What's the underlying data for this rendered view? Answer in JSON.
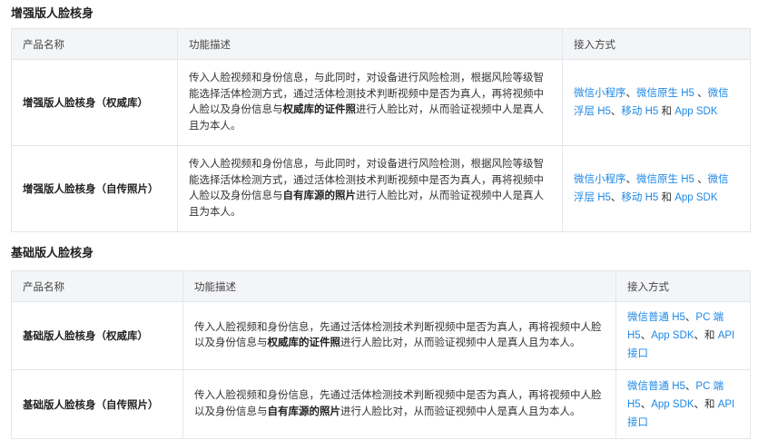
{
  "sections": [
    {
      "title": "增强版人脸核身",
      "headers": [
        "产品名称",
        "功能描述",
        "接入方式"
      ],
      "rows": [
        {
          "name": "增强版人脸核身（权威库）",
          "desc_before": "传入人脸视频和身份信息，与此同时，对设备进行风险检测，根据风险等级智能选择活体检测方式，通过活体检测技术判断视频中是否为真人，再将视频中人脸以及身份信息与",
          "desc_bold": "权威库的证件照",
          "desc_after": "进行人脸比对，从而验证视频中人是真人且为本人。",
          "access": [
            {
              "t": "微信小程序",
              "link": true
            },
            {
              "t": "、",
              "link": false
            },
            {
              "t": "微信原生 H5",
              "link": true
            },
            {
              "t": " 、",
              "link": false
            },
            {
              "t": "微信浮层 H5",
              "link": true
            },
            {
              "t": "、",
              "link": false
            },
            {
              "t": "移动 H5",
              "link": true
            },
            {
              "t": " 和 ",
              "link": false
            },
            {
              "t": "App SDK",
              "link": true
            }
          ]
        },
        {
          "name": "增强版人脸核身（自传照片）",
          "desc_before": "传入人脸视频和身份信息，与此同时，对设备进行风险检测，根据风险等级智能选择活体检测方式，通过活体检测技术判断视频中是否为真人，再将视频中人脸以及身份信息与",
          "desc_bold": "自有库源的照片",
          "desc_after": "进行人脸比对，从而验证视频中人是真人且为本人。",
          "access": [
            {
              "t": "微信小程序",
              "link": true
            },
            {
              "t": "、",
              "link": false
            },
            {
              "t": "微信原生 H5",
              "link": true
            },
            {
              "t": " 、",
              "link": false
            },
            {
              "t": "微信浮层 H5",
              "link": true
            },
            {
              "t": "、",
              "link": false
            },
            {
              "t": "移动 H5",
              "link": true
            },
            {
              "t": " 和 ",
              "link": false
            },
            {
              "t": "App SDK",
              "link": true
            }
          ]
        }
      ]
    },
    {
      "title": "基础版人脸核身",
      "headers": [
        "产品名称",
        "功能描述",
        "接入方式"
      ],
      "rows": [
        {
          "name": "基础版人脸核身（权威库）",
          "desc_before": "传入人脸视频和身份信息，先通过活体检测技术判断视频中是否为真人，再将视频中人脸以及身份信息与",
          "desc_bold": "权威库的证件照",
          "desc_after": "进行人脸比对，从而验证视频中人是真人且为本人。",
          "access": [
            {
              "t": "微信普通 H5",
              "link": true
            },
            {
              "t": "、",
              "link": false
            },
            {
              "t": "PC 端 H5",
              "link": true
            },
            {
              "t": "、",
              "link": false
            },
            {
              "t": "App SDK",
              "link": true
            },
            {
              "t": "、和 ",
              "link": false
            },
            {
              "t": "API 接口",
              "link": true
            }
          ]
        },
        {
          "name": "基础版人脸核身（自传照片）",
          "desc_before": "传入人脸视频和身份信息，先通过活体检测技术判断视频中是否为真人，再将视频中人脸以及身份信息与",
          "desc_bold": "自有库源的照片",
          "desc_after": "进行人脸比对，从而验证视频中人是真人且为本人。",
          "access": [
            {
              "t": "微信普通 H5",
              "link": true
            },
            {
              "t": "、",
              "link": false
            },
            {
              "t": "PC 端 H5",
              "link": true
            },
            {
              "t": "、",
              "link": false
            },
            {
              "t": "App SDK",
              "link": true
            },
            {
              "t": "、和 ",
              "link": false
            },
            {
              "t": "API 接口",
              "link": true
            }
          ]
        }
      ]
    }
  ]
}
